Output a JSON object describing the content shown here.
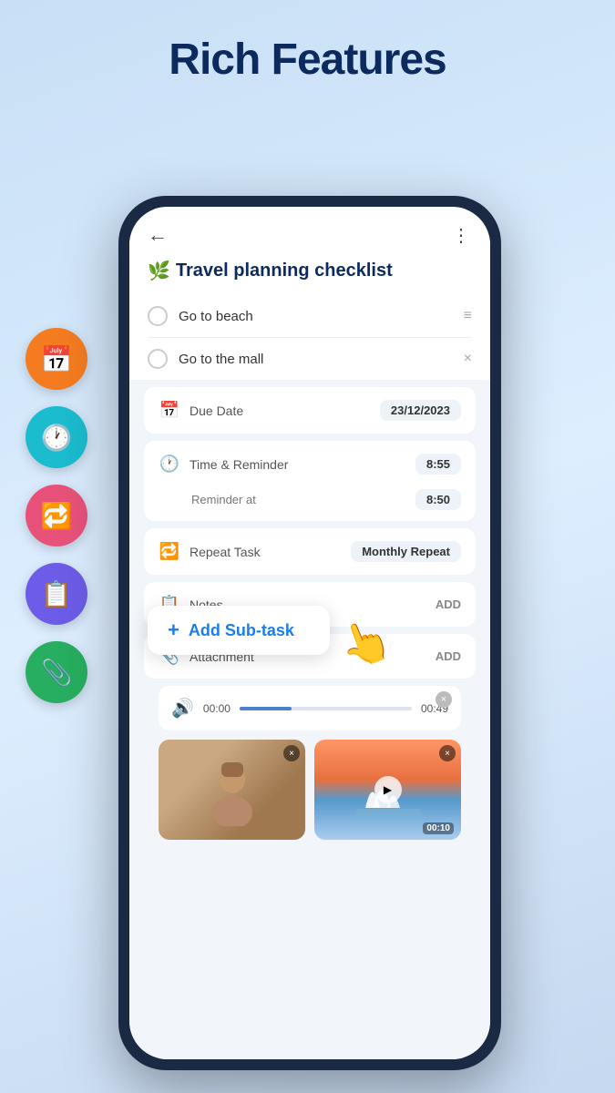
{
  "page": {
    "title": "Rich Features"
  },
  "side_icons": [
    {
      "id": "calendar",
      "color_class": "icon-orange",
      "emoji": "📅"
    },
    {
      "id": "clock",
      "color_class": "icon-teal",
      "emoji": "🕐"
    },
    {
      "id": "repeat",
      "color_class": "icon-pink",
      "emoji": "🔁"
    },
    {
      "id": "notes",
      "color_class": "icon-purple",
      "emoji": "📋"
    },
    {
      "id": "attach",
      "color_class": "icon-green",
      "emoji": "📎"
    }
  ],
  "screen": {
    "task_title_emoji": "🌿",
    "task_title": "Travel planning checklist",
    "back_label": "←",
    "more_label": "⋮",
    "tasks": [
      {
        "text": "Go to beach",
        "action": "≡"
      },
      {
        "text": "Go to the mall",
        "action": "×"
      }
    ],
    "add_subtask_label": "Add Sub-task",
    "add_subtask_plus": "+",
    "hand_emoji": "👆",
    "details": [
      {
        "id": "due-date",
        "icon": "📅",
        "label": "Due Date",
        "value": "23/12/2023",
        "type": "value"
      },
      {
        "id": "time-reminder",
        "icon": "🕐",
        "label": "Time & Reminder",
        "value": "8:55",
        "type": "value"
      },
      {
        "id": "reminder-at",
        "label": "Reminder at",
        "value": "8:50",
        "type": "sub"
      },
      {
        "id": "repeat-task",
        "icon": "🔁",
        "label": "Repeat Task",
        "value": "Monthly Repeat",
        "type": "value"
      },
      {
        "id": "notes",
        "icon": "📋",
        "label": "Notes",
        "value": "ADD",
        "type": "add"
      },
      {
        "id": "attachment",
        "icon": "📎",
        "label": "Attachment",
        "value": "ADD",
        "type": "add"
      }
    ],
    "audio": {
      "time_start": "00:00",
      "time_end": "00:49",
      "close": "×"
    },
    "thumbnails": [
      {
        "id": "portrait",
        "type": "portrait",
        "close": "×"
      },
      {
        "id": "landscape",
        "type": "landscape",
        "close": "×",
        "duration": "00:10",
        "has_play": true
      }
    ]
  }
}
